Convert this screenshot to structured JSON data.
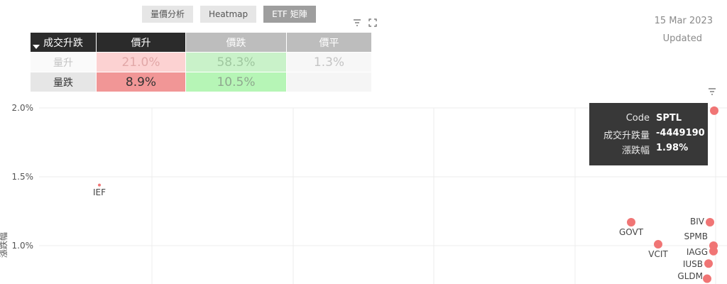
{
  "tabs": [
    {
      "label": "量價分析"
    },
    {
      "label": "Heatmap"
    },
    {
      "label": "ETF 矩陣"
    }
  ],
  "active_tab_index": 2,
  "toolbar_icons": [
    "filter-icon",
    "expand-icon"
  ],
  "header": {
    "date": "15 Mar 2023",
    "updated_label": "Updated"
  },
  "matrix": {
    "corner_label": "成交升跌",
    "columns": [
      "價升",
      "價跌",
      "價平"
    ],
    "rows": [
      {
        "label": "量升",
        "values": [
          "21.0%",
          "58.3%",
          "1.3%"
        ]
      },
      {
        "label": "量跌",
        "values": [
          "8.9%",
          "10.5%",
          ""
        ]
      }
    ]
  },
  "tooltip": {
    "rows": [
      {
        "key": "Code",
        "value": "SPTL"
      },
      {
        "key": "成交升跌量",
        "value": "-4449190"
      },
      {
        "key": "漲跌幅",
        "value": "1.98%"
      }
    ]
  },
  "chart_data": {
    "type": "scatter",
    "ylabel": "漲跌幅",
    "y_ticks": [
      "2.0%",
      "1.5%",
      "1.0%"
    ],
    "ylim": [
      0.75,
      2.0
    ],
    "grid": true,
    "colors": {
      "point": "#f07575"
    },
    "points": [
      {
        "label": "IEF",
        "y": 1.44,
        "small": true
      },
      {
        "label": "GOVT",
        "y": 1.17
      },
      {
        "label": "VCIT",
        "y": 1.01
      },
      {
        "label": "BIV",
        "y": 1.17
      },
      {
        "label": "SPMB",
        "y": 1.0
      },
      {
        "label": "IAGG",
        "y": 0.96
      },
      {
        "label": "IUSB",
        "y": 0.87
      },
      {
        "label": "GLDM",
        "y": 0.76
      },
      {
        "label": "SPTL",
        "y": 1.98
      }
    ]
  }
}
